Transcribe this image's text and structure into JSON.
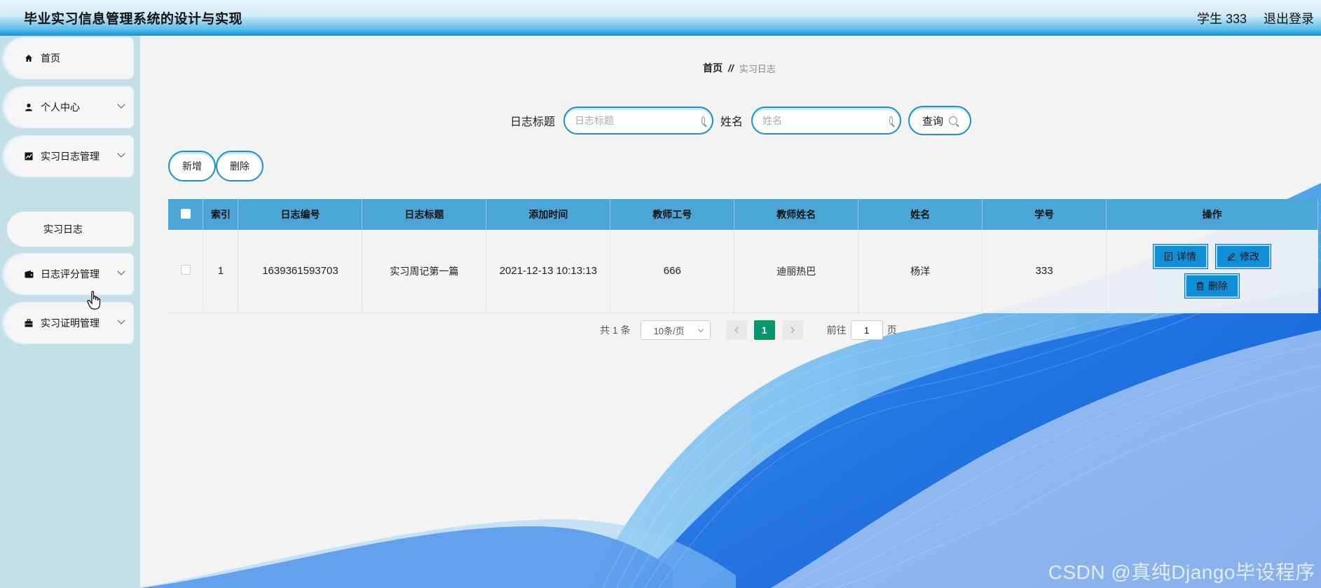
{
  "header": {
    "title": "毕业实习信息管理系统的设计与实现",
    "user": "学生 333",
    "logout": "退出登录"
  },
  "sidebar": {
    "items": [
      {
        "label": "首页",
        "icon": "home-icon"
      },
      {
        "label": "个人中心",
        "icon": "user-icon"
      },
      {
        "label": "实习日志管理",
        "icon": "chart-icon"
      },
      {
        "label": "日志评分管理",
        "icon": "wallet-icon"
      },
      {
        "label": "实习证明管理",
        "icon": "briefcase-icon"
      }
    ],
    "sub_item": "实习日志"
  },
  "breadcrumb": {
    "home": "首页",
    "separator": "//",
    "current": "实习日志"
  },
  "search": {
    "title_label": "日志标题",
    "title_placeholder": "日志标题",
    "name_label": "姓名",
    "name_placeholder": "姓名",
    "query_button": "查询"
  },
  "actions": {
    "add": "新增",
    "delete": "删除"
  },
  "table": {
    "columns": [
      "索引",
      "日志编号",
      "日志标题",
      "添加时间",
      "教师工号",
      "教师姓名",
      "姓名",
      "学号",
      "操作"
    ],
    "rows": [
      {
        "index": "1",
        "log_no": "1639361593703",
        "title": "实习周记第一篇",
        "added": "2021-12-13 10:13:13",
        "teacher_id": "666",
        "teacher_name": "迪丽热巴",
        "name": "杨洋",
        "student_no": "333"
      }
    ],
    "row_actions": {
      "detail": "详情",
      "edit": "修改",
      "delete": "删除"
    }
  },
  "pagination": {
    "total": "共 1 条",
    "page_size": "10条/页",
    "current_page": "1",
    "goto_prefix": "前往",
    "goto_value": "1",
    "goto_suffix": "页"
  },
  "watermark": "CSDN @真纯Django毕设程序",
  "colors": {
    "header_accent": "#1193d6",
    "table_header": "#4ba5d6",
    "active_page": "#09966b",
    "sidebar_bg": "#c5dfe9"
  }
}
